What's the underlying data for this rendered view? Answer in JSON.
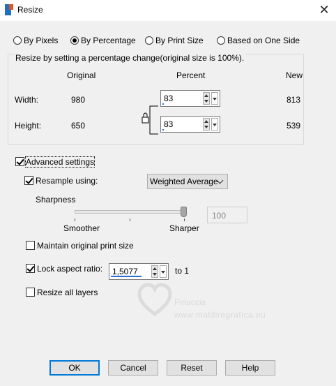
{
  "window": {
    "title": "Resize",
    "close_glyph": "✕"
  },
  "resize_mode": {
    "options": [
      "By Pixels",
      "By Percentage",
      "By Print Size",
      "Based on One Side"
    ],
    "selected": "By Percentage"
  },
  "group": {
    "title": "Resize by setting a percentage change(original size is 100%).",
    "headers": {
      "original": "Original",
      "percent": "Percent",
      "new": "New"
    },
    "width": {
      "label": "Width:",
      "original": "980",
      "percent": "83",
      "new": "813"
    },
    "height": {
      "label": "Height:",
      "original": "650",
      "percent": "83",
      "new": "539"
    }
  },
  "advanced": {
    "label": "Advanced settings",
    "checked": true,
    "resample": {
      "label": "Resample using:",
      "checked": true,
      "value": "Weighted Average"
    },
    "sharpness": {
      "label": "Sharpness",
      "min_label": "Smoother",
      "max_label": "Sharper",
      "value": "100",
      "level": 1.0
    },
    "maintain_print": {
      "label": "Maintain original print size",
      "checked": false
    },
    "lock_ratio": {
      "label": "Lock aspect ratio:",
      "checked": true,
      "value": "1,5077",
      "suffix": "to 1"
    },
    "resize_all": {
      "label": "Resize all layers",
      "checked": false
    }
  },
  "buttons": {
    "ok": "OK",
    "cancel": "Cancel",
    "reset": "Reset",
    "help": "Help"
  },
  "watermark": {
    "name": "Pinuccia",
    "url": "www.maldiregrafica.eu"
  },
  "colors": {
    "accent": "#0078d7",
    "progress": "#2a6fd6"
  }
}
